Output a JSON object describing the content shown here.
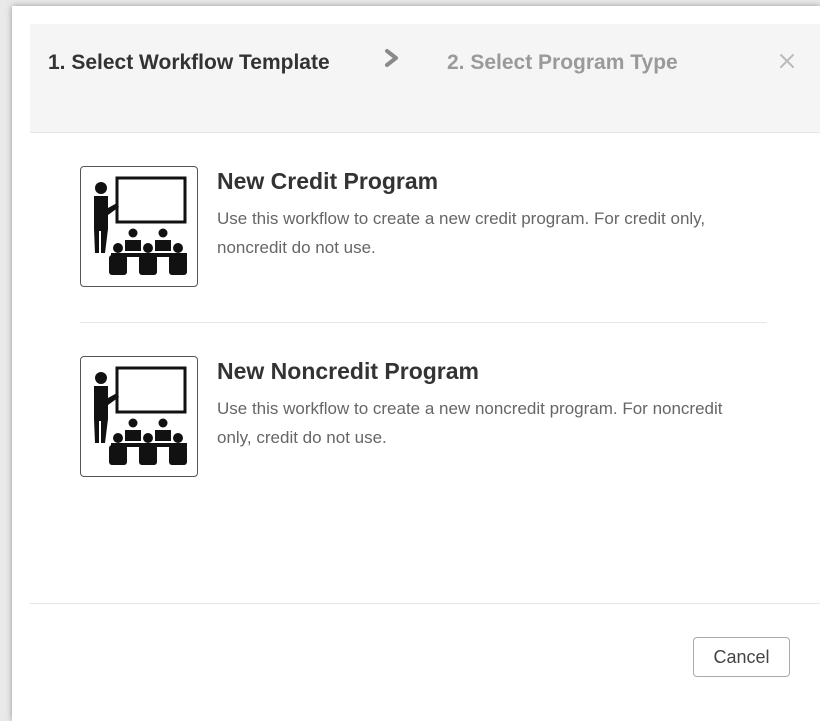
{
  "dialog": {
    "steps": [
      {
        "label": "1. Select Workflow Template",
        "active": true
      },
      {
        "label": "2. Select Program Type",
        "active": false
      }
    ],
    "step_separator_icon": "chevron-right-icon",
    "close_icon": "close-icon"
  },
  "options": [
    {
      "icon": "classroom-icon",
      "title": "New Credit Program",
      "description": "Use this workflow to create a new credit program. For credit only, noncredit do not use."
    },
    {
      "icon": "classroom-icon",
      "title": "New Noncredit Program",
      "description": "Use this workflow to create a new noncredit program. For noncredit only, credit do not use."
    }
  ],
  "footer": {
    "cancel_label": "Cancel"
  },
  "colors": {
    "header_background": "#f5f5f5",
    "active_step_text": "#333333",
    "inactive_step_text": "#9a9a9a",
    "description_text": "#666666"
  }
}
